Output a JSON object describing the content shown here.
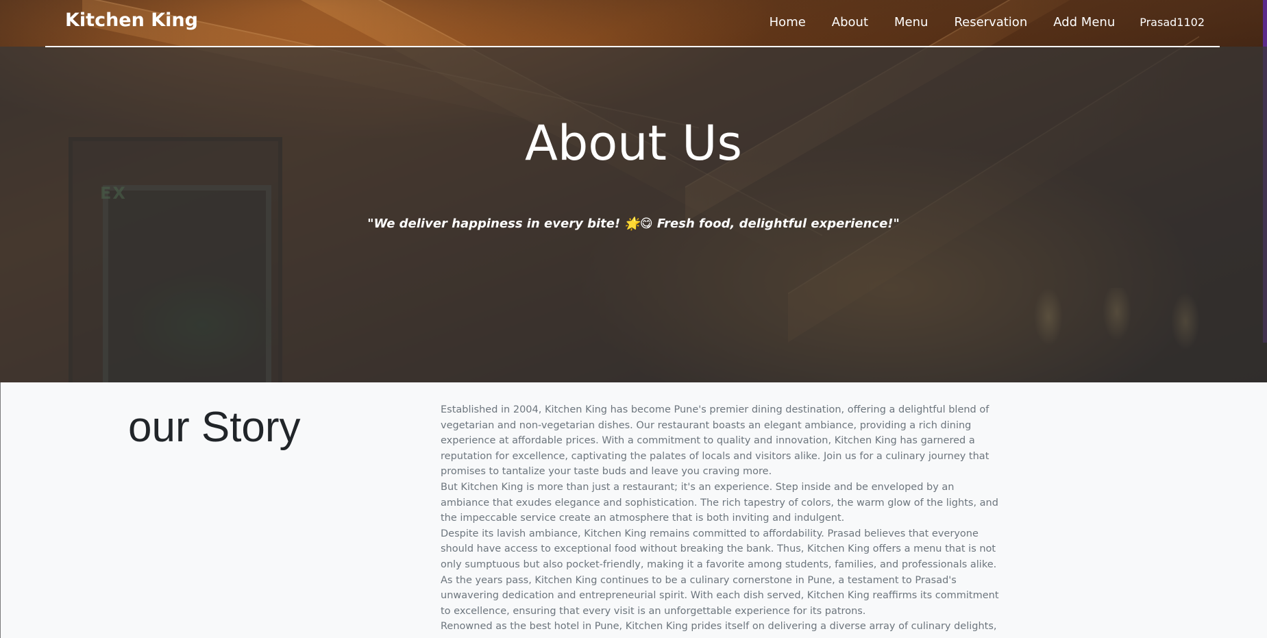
{
  "navbar": {
    "brand": "Kitchen King",
    "links": [
      "Home",
      "About",
      "Menu",
      "Reservation",
      "Add Menu"
    ],
    "user": "Prasad1102"
  },
  "hero": {
    "title": "About Us",
    "quote": "\"We deliver happiness in every bite! 🌟😋 Fresh food, delightful experience!\""
  },
  "story": {
    "heading": "our Story",
    "paragraphs": [
      "Established in 2004, Kitchen King has become Pune's premier dining destination, offering a delightful blend of vegetarian and non-vegetarian dishes. Our restaurant boasts an elegant ambiance, providing a rich dining experience at affordable prices. With a commitment to quality and innovation, Kitchen King has garnered a reputation for excellence, captivating the palates of locals and visitors alike. Join us for a culinary journey that promises to tantalize your taste buds and leave you craving more.",
      "But Kitchen King is more than just a restaurant; it's an experience. Step inside and be enveloped by an ambiance that exudes elegance and sophistication. The rich tapestry of colors, the warm glow of the lights, and the impeccable service create an atmosphere that is both inviting and indulgent.",
      "Despite its lavish ambiance, Kitchen King remains committed to affordability. Prasad believes that everyone should have access to exceptional food without breaking the bank. Thus, Kitchen King offers a menu that is not only sumptuous but also pocket-friendly, making it a favorite among students, families, and professionals alike.",
      "As the years pass, Kitchen King continues to be a culinary cornerstone in Pune, a testament to Prasad's unwavering dedication and entrepreneurial spirit. With each dish served, Kitchen King reaffirms its commitment to excellence, ensuring that every visit is an unforgettable experience for its patrons.",
      "Renowned as the best hotel in Pune, Kitchen King prides itself on delivering a diverse array of culinary delights,"
    ]
  }
}
